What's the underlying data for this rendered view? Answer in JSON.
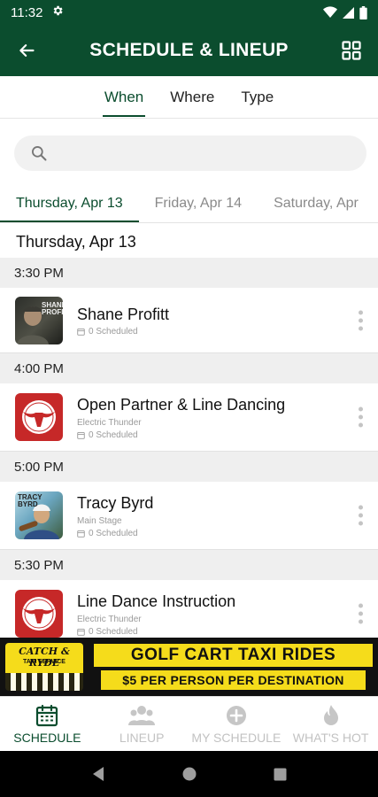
{
  "status_bar": {
    "time": "11:32"
  },
  "app_bar": {
    "title": "SCHEDULE & LINEUP"
  },
  "filter_tabs": [
    {
      "label": "When",
      "active": true
    },
    {
      "label": "Where",
      "active": false
    },
    {
      "label": "Type",
      "active": false
    }
  ],
  "search": {
    "placeholder": ""
  },
  "day_tabs": [
    {
      "label": "Thursday, Apr 13",
      "active": true
    },
    {
      "label": "Friday, Apr 14",
      "active": false
    },
    {
      "label": "Saturday, Apr",
      "active": false
    }
  ],
  "day_heading": "Thursday, Apr 13",
  "slots": [
    {
      "time": "3:30 PM",
      "event": {
        "title": "Shane Profitt",
        "venue": "",
        "scheduled": "0 Scheduled",
        "thumb_text": "SHANE PROFITT"
      }
    },
    {
      "time": "4:00 PM",
      "event": {
        "title": "Open Partner & Line Dancing",
        "venue": "Electric Thunder",
        "scheduled": "0 Scheduled"
      }
    },
    {
      "time": "5:00 PM",
      "event": {
        "title": "Tracy Byrd",
        "venue": "Main Stage",
        "scheduled": "0 Scheduled",
        "thumb_text": "TRACY BYRD"
      }
    },
    {
      "time": "5:30 PM",
      "event": {
        "title": "Line Dance Instruction",
        "venue": "Electric Thunder",
        "scheduled": "0 Scheduled"
      }
    }
  ],
  "ad": {
    "logo_line1": "CATCH & RYDE",
    "logo_line2": "TAXI SERVICE",
    "headline": "GOLF CART TAXI RIDES",
    "subline": "$5 PER PERSON PER DESTINATION"
  },
  "bottom_nav": [
    {
      "label": "SCHEDULE",
      "icon": "calendar-icon",
      "active": true
    },
    {
      "label": "LINEUP",
      "icon": "people-icon",
      "active": false
    },
    {
      "label": "MY SCHEDULE",
      "icon": "plus-circle-icon",
      "active": false
    },
    {
      "label": "WHAT'S HOT",
      "icon": "flame-icon",
      "active": false
    }
  ],
  "colors": {
    "primary": "#0b4d2e",
    "ad_yellow": "#f5dc1b",
    "logo_red": "#c62828"
  }
}
